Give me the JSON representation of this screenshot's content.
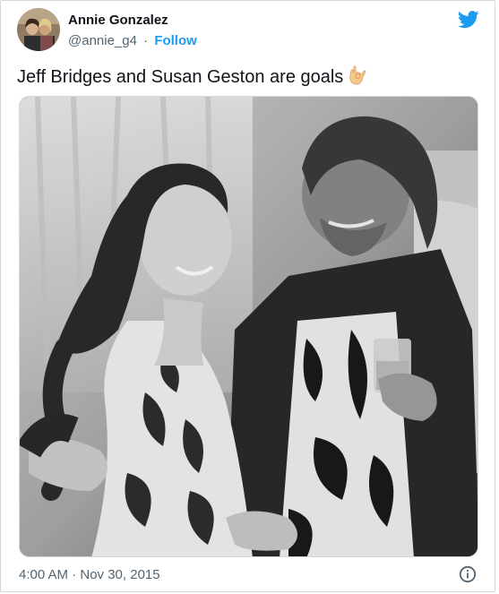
{
  "author": {
    "name": "Annie Gonzalez",
    "handle": "@annie_g4",
    "separator": "·",
    "follow_label": "Follow"
  },
  "tweet": {
    "text": "Jeff Bridges and Susan Geston are goals",
    "emoji": "ok-hand-emoji",
    "timestamp": "4:00 AM · Nov 30, 2015"
  },
  "icons": {
    "logo": "twitter-bird-icon",
    "info": "info-icon"
  },
  "colors": {
    "accent": "#1d9bf0",
    "text_primary": "#0f1419",
    "text_secondary": "#536471",
    "border": "#cfd9de"
  }
}
